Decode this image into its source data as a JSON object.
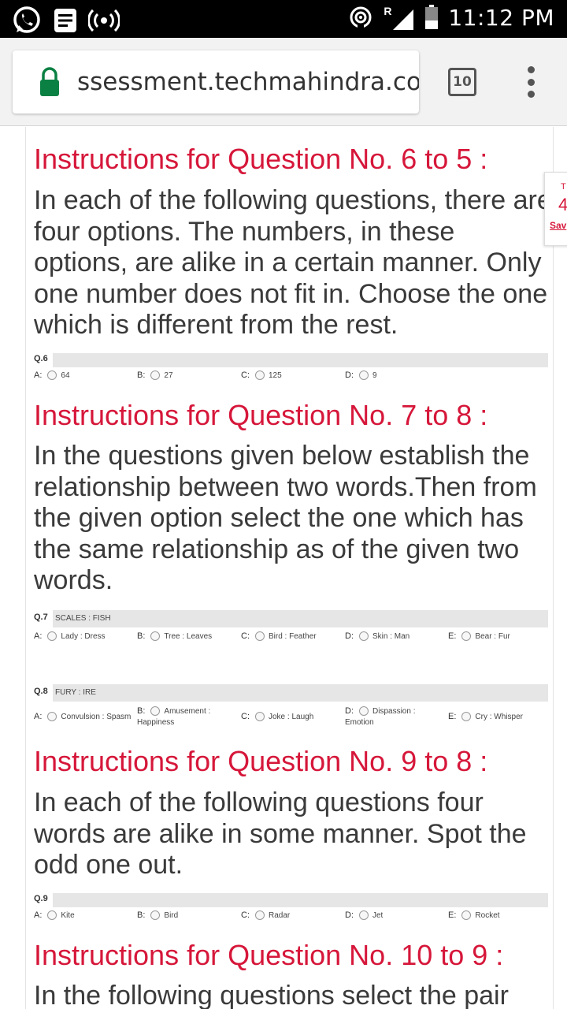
{
  "statusbar": {
    "time": "11:12 PM",
    "roaming": "R"
  },
  "browser": {
    "url": "ssessment.techmahindra.com",
    "tab_count": "10"
  },
  "side_widget": {
    "line1": "T",
    "line2": "4",
    "save": "Sav"
  },
  "sections": [
    {
      "title": "Instructions for Question No. 6 to 5 :",
      "text": "In each of the following questions, there are four options. The numbers, in these options, are alike in a certain manner. Only one number does not fit in. Choose the one which is different from the rest."
    },
    {
      "title": "Instructions for Question No. 7 to 8 :",
      "text": "In the questions given below establish the relationship between two words.Then from the given option select the one which has the same relationship as of the given two words."
    },
    {
      "title": "Instructions for Question No. 9 to 8 :",
      "text": "In each of the following questions four words are alike in some manner. Spot the odd one out."
    },
    {
      "title": "Instructions for Question No. 10 to 9 :",
      "text": "In the following questions select the pair"
    }
  ],
  "questions": {
    "q6": {
      "number": "Q.6",
      "prompt": "",
      "options": [
        {
          "letter": "A:",
          "text": "64"
        },
        {
          "letter": "B:",
          "text": "27"
        },
        {
          "letter": "C:",
          "text": "125"
        },
        {
          "letter": "D:",
          "text": "9"
        }
      ]
    },
    "q7": {
      "number": "Q.7",
      "prompt": "SCALES : FISH",
      "options": [
        {
          "letter": "A:",
          "text": "Lady : Dress"
        },
        {
          "letter": "B:",
          "text": "Tree : Leaves"
        },
        {
          "letter": "C:",
          "text": "Bird : Feather"
        },
        {
          "letter": "D:",
          "text": "Skin : Man"
        },
        {
          "letter": "E:",
          "text": "Bear : Fur"
        }
      ]
    },
    "q8": {
      "number": "Q.8",
      "prompt": "FURY : IRE",
      "options": [
        {
          "letter": "A:",
          "text": "Convulsion : Spasm"
        },
        {
          "letter": "B:",
          "text": "Amusement :",
          "text2": "Happiness"
        },
        {
          "letter": "C:",
          "text": "Joke : Laugh"
        },
        {
          "letter": "D:",
          "text": "Dispassion :",
          "text2": "Emotion"
        },
        {
          "letter": "E:",
          "text": "Cry : Whisper"
        }
      ]
    },
    "q9": {
      "number": "Q.9",
      "prompt": "",
      "options": [
        {
          "letter": "A:",
          "text": "Kite"
        },
        {
          "letter": "B:",
          "text": "Bird"
        },
        {
          "letter": "C:",
          "text": "Radar"
        },
        {
          "letter": "D:",
          "text": "Jet"
        },
        {
          "letter": "E:",
          "text": "Rocket"
        }
      ]
    }
  }
}
